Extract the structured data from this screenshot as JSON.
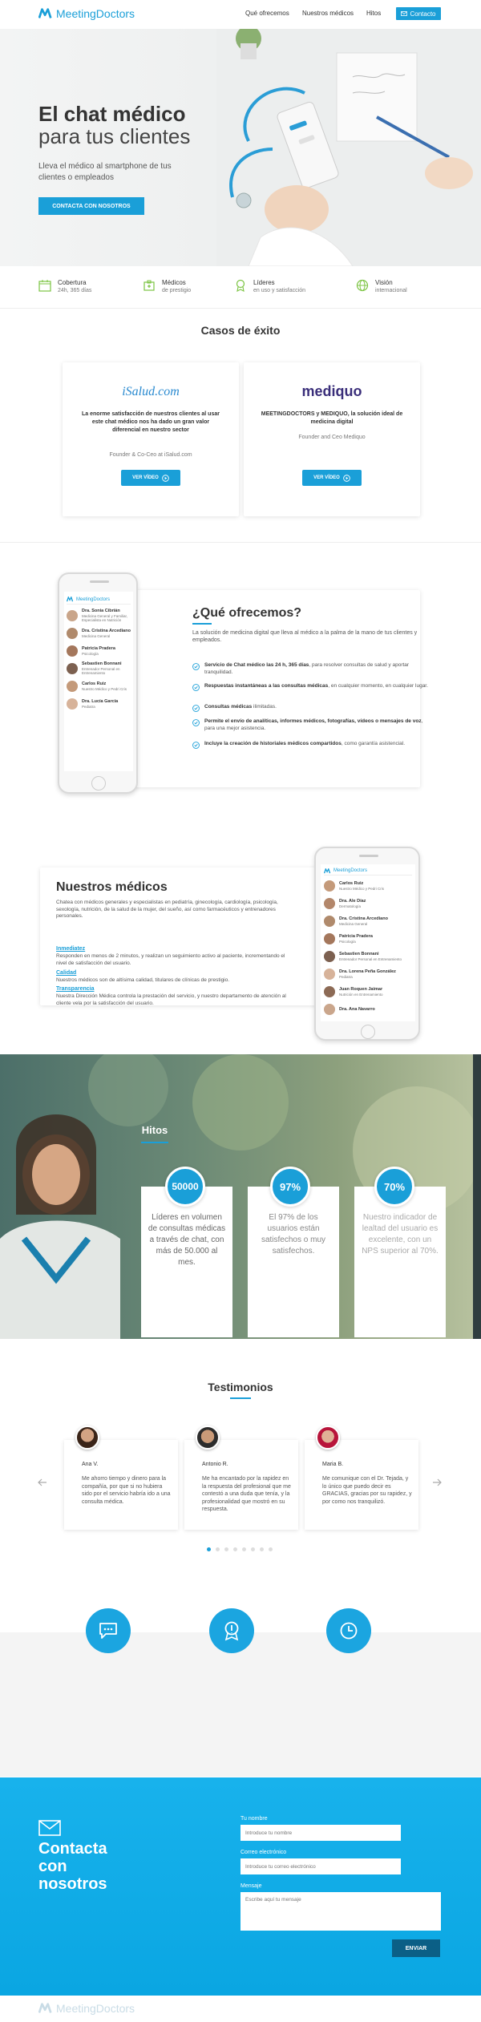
{
  "nav": {
    "logo": "MeetingDoctors",
    "links": [
      "Qué ofrecemos",
      "Nuestros médicos",
      "Hitos"
    ],
    "contact": "Contacto"
  },
  "hero": {
    "title_line1": "El chat médico",
    "title_line2": "para tus clientes",
    "subtitle": "Lleva el médico al smartphone de tus clientes o empleados",
    "cta": "CONTACTA CON NOSOTROS"
  },
  "features": [
    {
      "title": "Cobertura",
      "sub": "24h, 365 días",
      "icon": "calendar-icon"
    },
    {
      "title": "Médicos",
      "sub": "de prestigio",
      "icon": "doctor-icon"
    },
    {
      "title": "Líderes",
      "sub": "en uso y satisfacción",
      "icon": "award-icon"
    },
    {
      "title": "Visión",
      "sub": "internacional",
      "icon": "globe-icon"
    }
  ],
  "cases": {
    "title": "Casos de éxito",
    "items": [
      {
        "logo": "iSalud.com",
        "text": "La enorme satisfacción de nuestros clientes al usar este chat médico nos ha dado un gran valor diferencial en nuestro sector",
        "by": "Founder & Co-Ceo at iSalud.com",
        "button": "VER VÍDEO"
      },
      {
        "logo": "mediquo",
        "text": "MEETINGDOCTORS y MEDIQUO, la solución ideal de medicina digital",
        "by": "Founder and Ceo Mediquo",
        "button": "VER VÍDEO"
      }
    ]
  },
  "offer": {
    "title": "¿Qué ofrecemos?",
    "lead": "La solución de medicina digital que lleva al médico a la palma de la mano de tus clientes y empleados.",
    "items": [
      {
        "bold": "Servicio de Chat médico las 24 h, 365 días",
        "rest": ", para resolver consultas de salud y aportar tranquilidad."
      },
      {
        "bold": "Respuestas instantáneas a las consultas médicas",
        "rest": ", en cualquier momento, en cualquier lugar."
      },
      {
        "bold": "Consultas médicas",
        "rest": " ilimitadas."
      },
      {
        "bold": "Permite el envío de analíticas, informes médicos, fotografías, vídeos o mensajes de voz",
        "rest": ", para una mejor asistencia."
      },
      {
        "bold": "Incluye la creación de historiales médicos compartidos",
        "rest": ", como garantía asistencial."
      }
    ]
  },
  "phone1": {
    "app": "MeetingDoctors",
    "doctors": [
      {
        "name": "Dra. Sonia Cibrián",
        "spec": "Medicina General y Familiar, Especialista en Nutrición"
      },
      {
        "name": "Dra. Cristina Arcediano",
        "spec": "Medicina General"
      },
      {
        "name": "Patricia Pradera",
        "spec": "Psicología"
      },
      {
        "name": "Sebastien Bonnani",
        "spec": "Entrenador Personal en Entrenamiento"
      },
      {
        "name": "Carlos Ruiz",
        "spec": "Nuestro Médico y Pedri Cris"
      },
      {
        "name": "Dra. Lucía García",
        "spec": "Pediatra"
      }
    ]
  },
  "medicos": {
    "title": "Nuestros médicos",
    "lead": "Chatea con médicos generales y especialistas en pediatría, ginecología, cardiología, psicología, sexología, nutrición, de la salud de la mujer, del sueño, así como farmacéuticos y entrenadores personales.",
    "blocks": [
      {
        "title": "Inmediatez",
        "text": "Responden en menos de 2 minutos, y realizan un seguimiento activo al paciente, incrementando el nivel de satisfacción del usuario."
      },
      {
        "title": "Calidad",
        "text": "Nuestros médicos son de altísima calidad, titulares de clínicas de prestigio."
      },
      {
        "title": "Transparencia",
        "text": "Nuestra Dirección Médica controla la prestación del servicio, y nuestro departamento de atención al cliente vela por la satisfacción del usuario."
      }
    ]
  },
  "phone2": {
    "app": "MeetingDoctors",
    "doctors": [
      {
        "name": "Carlos Ruiz",
        "spec": "Nuestro Médico y Pedri Cris"
      },
      {
        "name": "Dra. Ale Díaz",
        "spec": "Dermatología"
      },
      {
        "name": "Dra. Cristina Arcediano",
        "spec": "Medicina General"
      },
      {
        "name": "Patricia Pradera",
        "spec": "Psicología"
      },
      {
        "name": "Sebastien Bonnani",
        "spec": "Entrenador Personal en Entrenamiento"
      },
      {
        "name": "Dra. Lorena Peña González",
        "spec": "Pediatra"
      },
      {
        "name": "Juan Roquen Jaimar",
        "spec": "Nutrición en Entrenamiento"
      },
      {
        "name": "Dra. Ana Navarro",
        "spec": ""
      }
    ]
  },
  "hitos": {
    "title": "Hitos",
    "items": [
      {
        "value": "50000",
        "text": "Líderes en volumen de consultas médicas a través de chat, con más de 50.000 al mes."
      },
      {
        "value": "97%",
        "text": "El 97% de los usuarios están satisfechos o muy satisfechos."
      },
      {
        "value": "70%",
        "text": "Nuestro indicador de lealtad del usuario es excelente, con un NPS superior al 70%."
      }
    ]
  },
  "testimonios": {
    "title": "Testimonios",
    "items": [
      {
        "name": "Ana V.",
        "quote": "Me ahorro tiempo y dinero para la compañía, por que si no hubiera sido por el servicio habría ido a una consulta médica."
      },
      {
        "name": "Antonio R.",
        "quote": "Me ha encantado por la rapidez en la respuesta del profesional que me contestó a una duda que tenía, y la profesionalidad que mostró en su respuesta."
      },
      {
        "name": "Maria B.",
        "quote": "Me comunique con el Dr. Tejada, y lo único que puedo decir es GRACIAS, gracias por su rapidez, y por como nos tranquilizó."
      }
    ]
  },
  "contacto": {
    "title_lines": [
      "Contacta",
      "con",
      "nosotros"
    ],
    "name_label": "Tu nombre",
    "name_placeholder": "Introduce tu nombre",
    "email_label": "Correo electrónico",
    "email_placeholder": "Introduce tu correo electrónico",
    "msg_label": "Mensaje",
    "msg_placeholder": "Escribe aquí tu mensaje",
    "send": "ENVIAR"
  },
  "footer": {
    "logo": "MeetingDoctors"
  },
  "colors": {
    "accent": "#1a9fd8",
    "contact_bg": "#13aee9",
    "send": "#0b5f86"
  }
}
